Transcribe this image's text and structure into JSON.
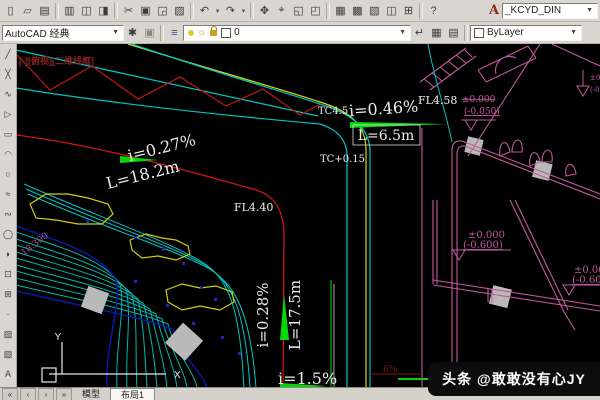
{
  "colors": {
    "canvas_bg": "#000000",
    "toolbar_bg": "#d9d6cf",
    "cyan": "#00c6c6",
    "teal_band": "#00b8ab",
    "navy": "#0a18a8",
    "red_centerline": "#cc1616",
    "dark_red": "#7c1d1d",
    "yellow": "#d8d810",
    "green_arrow": "#05d805",
    "magenta": "#c25a9b",
    "white_text": "#ececec",
    "viewport_label_red": "#8b2525"
  },
  "toolbar_row1": {
    "icons": [
      {
        "name": "new",
        "glyph": "▯"
      },
      {
        "name": "open",
        "glyph": "▱"
      },
      {
        "name": "save",
        "glyph": "▤"
      },
      {
        "name": "plot",
        "glyph": "▥"
      },
      {
        "name": "preview",
        "glyph": "◫"
      },
      {
        "name": "publish",
        "glyph": "◨"
      },
      {
        "name": "cut",
        "glyph": "✂"
      },
      {
        "name": "copy",
        "glyph": "▣"
      },
      {
        "name": "paste",
        "glyph": "◲"
      },
      {
        "name": "matchprop",
        "glyph": "▨"
      },
      {
        "name": "undo",
        "glyph": "↶"
      },
      {
        "name": "undo-arrow",
        "glyph": "▾"
      },
      {
        "name": "redo",
        "glyph": "↷"
      },
      {
        "name": "redo-arrow",
        "glyph": "▾"
      },
      {
        "name": "pan",
        "glyph": "✥"
      },
      {
        "name": "zoom-realtime",
        "glyph": "⌖"
      },
      {
        "name": "zoom-window",
        "glyph": "◱"
      },
      {
        "name": "zoom-previous",
        "glyph": "◰"
      },
      {
        "name": "properties",
        "glyph": "▦"
      },
      {
        "name": "designcenter",
        "glyph": "▩"
      },
      {
        "name": "tool-palettes",
        "glyph": "▧"
      },
      {
        "name": "sheet-set",
        "glyph": "◫"
      },
      {
        "name": "calculator",
        "glyph": "⊞"
      },
      {
        "name": "help",
        "glyph": "?"
      }
    ],
    "style_icon": "A",
    "text_style": "_KCYD_DIN",
    "dropdown_arrow": "▼"
  },
  "toolbar_row2": {
    "workspace": "AutoCAD 经典",
    "gear_icon": "✱",
    "window_icon": "▣",
    "layer_manager_icon": "≡",
    "sun_icon": "☼",
    "layer_name": "0",
    "post_icons": [
      {
        "name": "layer-previous",
        "glyph": "↵"
      },
      {
        "name": "layer-states",
        "glyph": "▦"
      },
      {
        "name": "layer-isolate",
        "glyph": "▤"
      }
    ],
    "color_value": "ByLayer",
    "dropdown_arrow": "▼"
  },
  "left_toolbar": {
    "icons": [
      {
        "name": "line",
        "glyph": "╱"
      },
      {
        "name": "construction-line",
        "glyph": "╳"
      },
      {
        "name": "polyline",
        "glyph": "∿"
      },
      {
        "name": "polygon",
        "glyph": "▷"
      },
      {
        "name": "rectangle",
        "glyph": "▭"
      },
      {
        "name": "arc",
        "glyph": "◠"
      },
      {
        "name": "circle",
        "glyph": "○"
      },
      {
        "name": "revcloud",
        "glyph": "≈"
      },
      {
        "name": "spline",
        "glyph": "∾"
      },
      {
        "name": "ellipse",
        "glyph": "◯"
      },
      {
        "name": "ellipse-arc",
        "glyph": "◗"
      },
      {
        "name": "insert-block",
        "glyph": "⊡"
      },
      {
        "name": "make-block",
        "glyph": "⊞"
      },
      {
        "name": "point",
        "glyph": "·"
      },
      {
        "name": "hatch",
        "glyph": "▨"
      },
      {
        "name": "gradient",
        "glyph": "▧"
      },
      {
        "name": "mtext",
        "glyph": "A"
      }
    ]
  },
  "canvas": {
    "viewport_label": "[-][俯视][二维线框]",
    "labels": {
      "slope1": "i=0.27%",
      "len1": "L=18.2m",
      "tc1": "TC4.5",
      "slope2": "i=0.46%",
      "fl1": "FL4.58",
      "len2": "L=6.5m",
      "tc2": "TC+0.15",
      "fl2": "FL4.40",
      "slope3": "i=0.28%",
      "len3": "L=17.5m",
      "slope4": "i=1.5%",
      "slope6": "6%",
      "dim1": "18.300",
      "lvl_a1": "±0.000",
      "lvl_a2": "(-0.050)",
      "lvl_b1": "±0.000",
      "lvl_b2": "(-0.600)",
      "lvl_c1": "±0.00",
      "lvl_c2": "(-0.60",
      "lvl_d1": "±0.",
      "lvl_d2": "(-0."
    },
    "ucs": {
      "x": "X",
      "y": "Y"
    }
  },
  "tab_bar": {
    "nav_first": "«",
    "nav_prev": "‹",
    "nav_next": "›",
    "nav_last": "»",
    "model_tab": "模型",
    "layout_tab": "布局1"
  },
  "watermark": "头条 @敢敢没有心JY"
}
